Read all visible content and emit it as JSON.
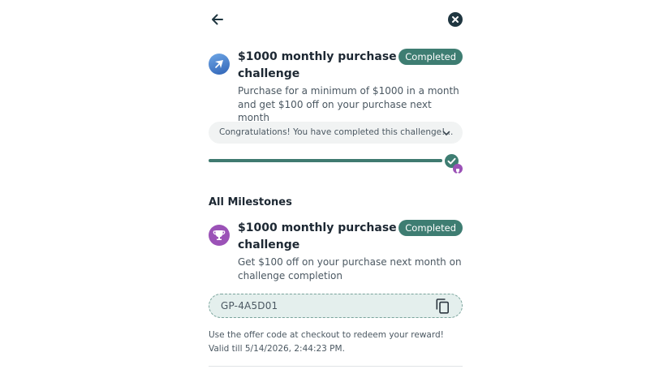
{
  "challenge": {
    "title": "$1000 monthly purchase challenge",
    "status": "Completed",
    "description": "Purchase for a minimum of $1000 in a month and get $100 off on your purchase next month",
    "congrats_message": "Congratulations! You have completed this challenge!...",
    "progress_fraction": 1.0
  },
  "milestones": {
    "section_title": "All Milestones",
    "items": [
      {
        "title": "$1000 monthly purchase challenge",
        "status": "Completed",
        "description": "Get $100 off on your purchase next month on challenge completion",
        "offer_code": "GP-4A5D01",
        "footnote": "Use the offer code at checkout to redeem your reward! Valid till 5/14/2026, 2:44:23 PM."
      }
    ]
  },
  "colors": {
    "accent": "#3e7d72",
    "trophy": "#9b52b7",
    "close_button": "#1f3640"
  },
  "icons": {
    "back": "arrow-left-icon",
    "close": "close-icon",
    "brand": "brand-logo-icon",
    "expand": "chevron-down-icon",
    "complete": "check-circle-icon",
    "reward": "trophy-icon",
    "copy": "copy-icon"
  }
}
